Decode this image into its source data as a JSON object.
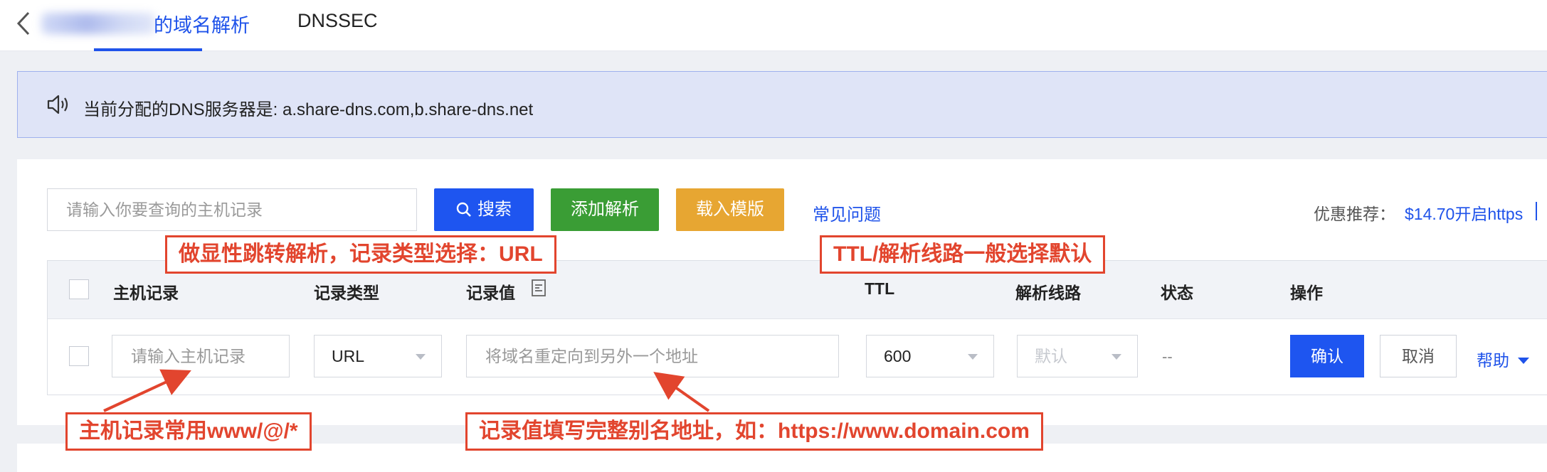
{
  "header": {
    "tab_active": "的域名解析",
    "tab_dnssec": "DNSSEC"
  },
  "notice": {
    "text": "当前分配的DNS服务器是: a.share-dns.com,b.share-dns.net"
  },
  "toolbar": {
    "search_placeholder": "请输入你要查询的主机记录",
    "search_label": "搜索",
    "add_label": "添加解析",
    "template_label": "载入模版",
    "faq_label": "常见问题",
    "promo_label": "优惠推荐：",
    "promo_link": "$14.70开启https"
  },
  "table": {
    "columns": [
      "主机记录",
      "记录类型",
      "记录值",
      "TTL",
      "解析线路",
      "状态",
      "操作"
    ],
    "row": {
      "host_placeholder": "请输入主机记录",
      "type_value": "URL",
      "value_placeholder": "将域名重定向到另外一个地址",
      "ttl_value": "600",
      "line_value": "默认",
      "status_value": "--",
      "confirm_label": "确认",
      "cancel_label": "取消",
      "help_label": "帮助"
    }
  },
  "annotations": {
    "record_type": "做显性跳转解析，记录类型选择：URL",
    "ttl_line": "TTL/解析线路一般选择默认",
    "host": "主机记录常用www/@/*",
    "value": "记录值填写完整别名地址，如：https://www.domain.com"
  },
  "colors": {
    "primary": "#1e55f0",
    "add_button": "#3a9d35",
    "template_button": "#e7a632",
    "annotation": "#e2452e",
    "notice_bg": "#dfe4f7"
  }
}
